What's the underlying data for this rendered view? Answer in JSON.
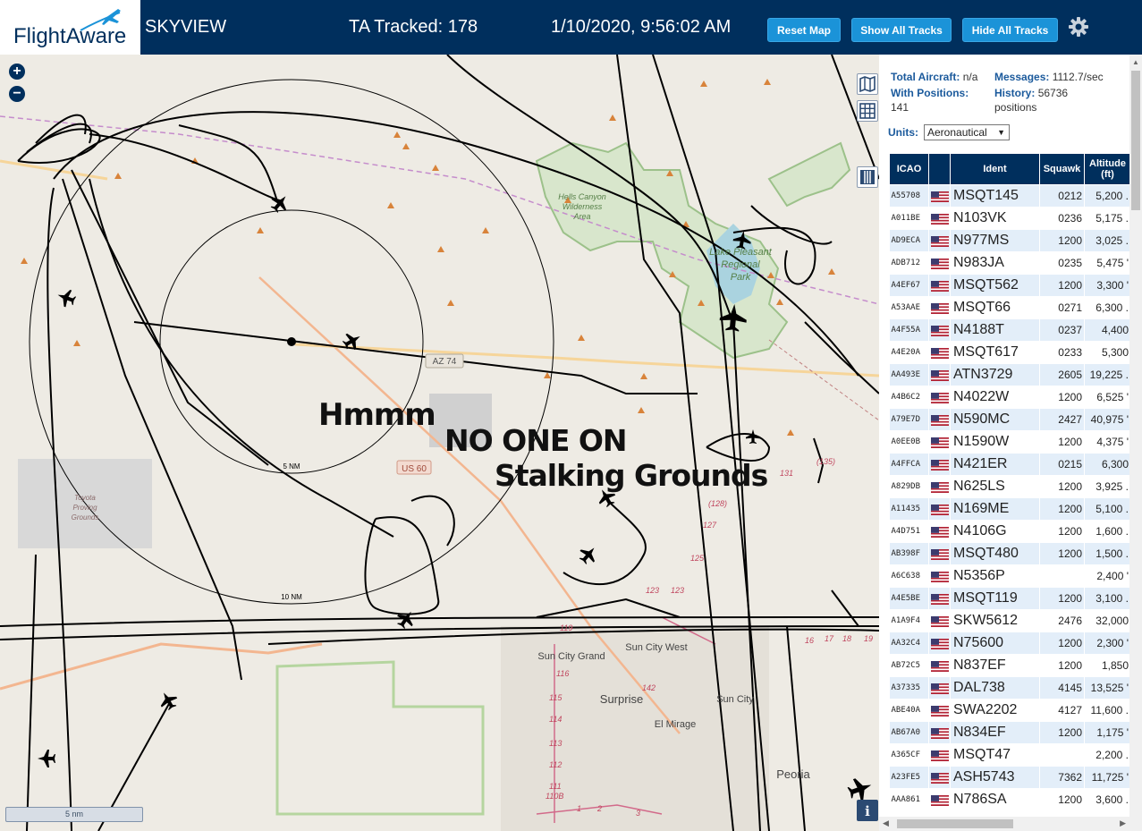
{
  "header": {
    "logo_text": "FlightAware",
    "app_title": "SKYVIEW",
    "tracked_label": "TA Tracked: 178",
    "datetime": "1/10/2020, 9:56:02 AM",
    "buttons": {
      "reset_map": "Reset Map",
      "show_all_tracks": "Show All Tracks",
      "hide_all_tracks": "Hide All Tracks"
    },
    "settings_icon": "gear-icon"
  },
  "map": {
    "zoom_in": "+",
    "zoom_out": "−",
    "labels": {
      "hells_canyon": "Hells Canyon",
      "wilderness": "Wilderness",
      "area": "Area",
      "lake_pleasant": "Lake Pleasant",
      "regional": "Regional",
      "park": "Park",
      "az74": "AZ 74",
      "us60": "US 60",
      "ring5": "5 NM",
      "ring10": "10 NM",
      "toyota": "Toyota",
      "proving": "Proving",
      "grounds": "Grounds",
      "sun_city_grand": "Sun City Grand",
      "sun_city_west": "Sun City West",
      "surprise": "Surprise",
      "sun_city": "Sun City",
      "el_mirage": "El Mirage",
      "peoria": "Peoria",
      "r116": "116",
      "r115": "115",
      "r114": "114",
      "r113": "113",
      "r112": "112",
      "r111": "111",
      "r110b": "110B",
      "r142": "142",
      "r119": "119",
      "r125": "125",
      "r127": "127",
      "r128": "(128)",
      "r131": "131",
      "r135": "(135)",
      "r123a": "123",
      "r123b": "123",
      "r17": "17",
      "r18": "18",
      "r19": "19",
      "r16": "16",
      "r1": "1",
      "r2": "2",
      "r3": "3"
    },
    "overlay_text": {
      "hmmm": "Hmmm",
      "no_one_on": "NO ONE ON",
      "stalking_grounds": "Stalking Grounds"
    },
    "scale_label": "5 nm",
    "map_type_icon": "map-icon",
    "grid_icon": "grid-icon",
    "columns_icon": "columns-icon",
    "info_icon": "info-icon"
  },
  "sidebar": {
    "total_aircraft_label": "Total Aircraft:",
    "total_aircraft_value": "n/a",
    "messages_label": "Messages:",
    "messages_value": "1112.7/sec",
    "with_positions_label": "With Positions:",
    "with_positions_value": "141",
    "history_label": "History:",
    "history_value": "56736",
    "history_unit": "positions",
    "units_label": "Units:",
    "units_value": "Aeronautical",
    "columns": [
      "ICAO",
      "",
      "Ident",
      "Squawk",
      "Altitude (ft)"
    ],
    "rows": [
      {
        "icao": "A55708",
        "ident": "MSQT145",
        "squawk": "0212",
        "alt": "5,200 ."
      },
      {
        "icao": "A011BE",
        "ident": "N103VK",
        "squawk": "0236",
        "alt": "5,175 ."
      },
      {
        "icao": "AD9ECA",
        "ident": "N977MS",
        "squawk": "1200",
        "alt": "3,025 ."
      },
      {
        "icao": "ADB712",
        "ident": "N983JA",
        "squawk": "0235",
        "alt": "5,475 '"
      },
      {
        "icao": "A4EF67",
        "ident": "MSQT562",
        "squawk": "1200",
        "alt": "3,300 '"
      },
      {
        "icao": "A53AAE",
        "ident": "MSQT66",
        "squawk": "0271",
        "alt": "6,300 ."
      },
      {
        "icao": "A4F55A",
        "ident": "N4188T",
        "squawk": "0237",
        "alt": "4,400"
      },
      {
        "icao": "A4E20A",
        "ident": "MSQT617",
        "squawk": "0233",
        "alt": "5,300"
      },
      {
        "icao": "AA493E",
        "ident": "ATN3729",
        "squawk": "2605",
        "alt": "19,225 ."
      },
      {
        "icao": "A4B6C2",
        "ident": "N4022W",
        "squawk": "1200",
        "alt": "6,525 '"
      },
      {
        "icao": "A79E7D",
        "ident": "N590MC",
        "squawk": "2427",
        "alt": "40,975 '"
      },
      {
        "icao": "A0EE0B",
        "ident": "N1590W",
        "squawk": "1200",
        "alt": "4,375 '"
      },
      {
        "icao": "A4FFCA",
        "ident": "N421ER",
        "squawk": "0215",
        "alt": "6,300"
      },
      {
        "icao": "A829DB",
        "ident": "N625LS",
        "squawk": "1200",
        "alt": "3,925 ."
      },
      {
        "icao": "A11435",
        "ident": "N169ME",
        "squawk": "1200",
        "alt": "5,100 ."
      },
      {
        "icao": "A4D751",
        "ident": "N4106G",
        "squawk": "1200",
        "alt": "1,600 ."
      },
      {
        "icao": "AB398F",
        "ident": "MSQT480",
        "squawk": "1200",
        "alt": "1,500 ."
      },
      {
        "icao": "A6C638",
        "ident": "N5356P",
        "squawk": "",
        "alt": "2,400 '"
      },
      {
        "icao": "A4E5BE",
        "ident": "MSQT119",
        "squawk": "1200",
        "alt": "3,100 ."
      },
      {
        "icao": "A1A9F4",
        "ident": "SKW5612",
        "squawk": "2476",
        "alt": "32,000"
      },
      {
        "icao": "AA32C4",
        "ident": "N75600",
        "squawk": "1200",
        "alt": "2,300 '"
      },
      {
        "icao": "AB72C5",
        "ident": "N837EF",
        "squawk": "1200",
        "alt": "1,850"
      },
      {
        "icao": "A37335",
        "ident": "DAL738",
        "squawk": "4145",
        "alt": "13,525 '"
      },
      {
        "icao": "ABE40A",
        "ident": "SWA2202",
        "squawk": "4127",
        "alt": "11,600 ."
      },
      {
        "icao": "AB67A0",
        "ident": "N834EF",
        "squawk": "1200",
        "alt": "1,175 '"
      },
      {
        "icao": "A365CF",
        "ident": "MSQT47",
        "squawk": "",
        "alt": "2,200 ."
      },
      {
        "icao": "A23FE5",
        "ident": "ASH5743",
        "squawk": "7362",
        "alt": "11,725 '"
      },
      {
        "icao": "AAA861",
        "ident": "N786SA",
        "squawk": "1200",
        "alt": "3,600 ."
      }
    ]
  },
  "colors": {
    "header_bg": "#002f5d",
    "button_bg": "#1b93d8",
    "track": "#000000",
    "range_ring": "#000000",
    "route_shield": "#c0675a"
  }
}
